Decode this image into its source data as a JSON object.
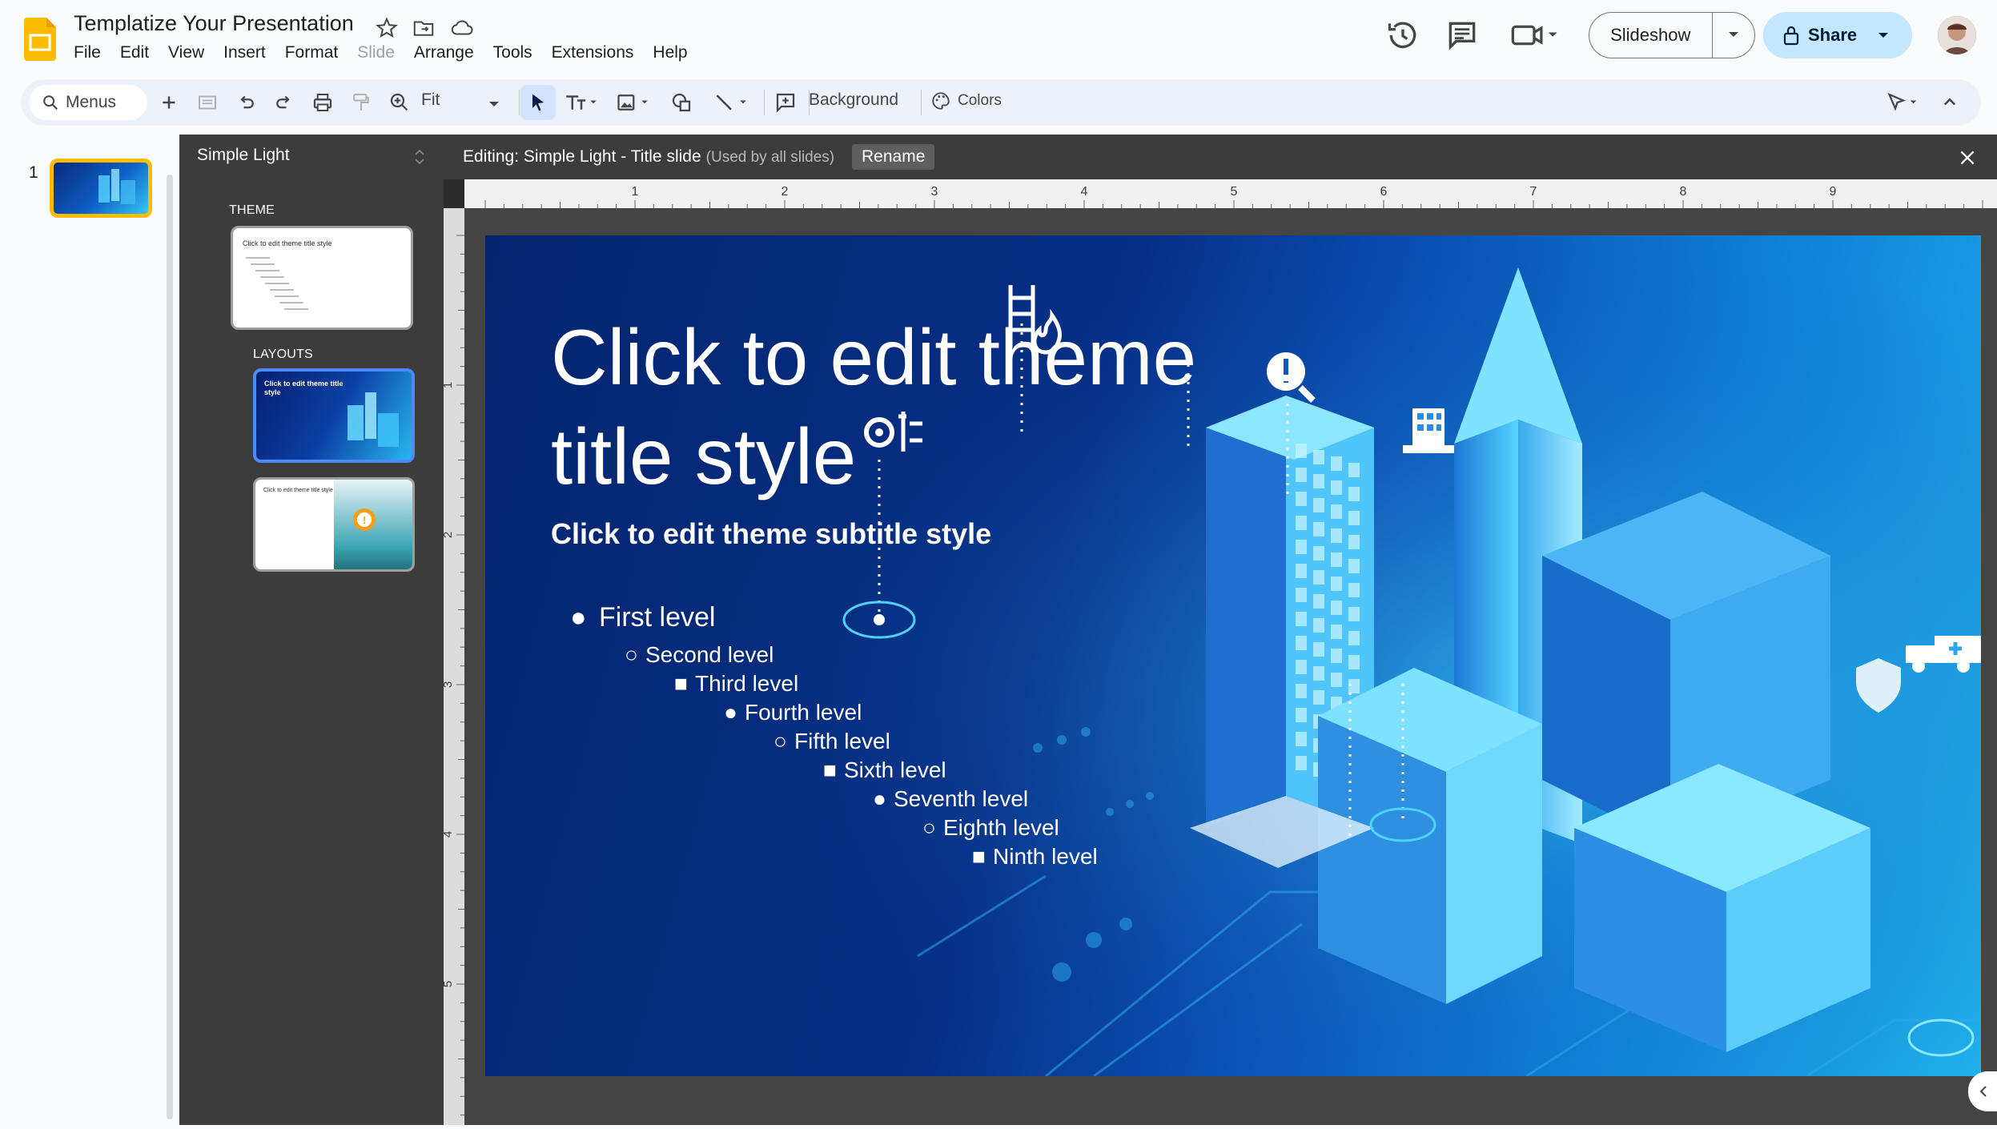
{
  "app": {
    "title": "Templatize Your Presentation",
    "menu": [
      "File",
      "Edit",
      "View",
      "Insert",
      "Format",
      "Slide",
      "Arrange",
      "Tools",
      "Extensions",
      "Help"
    ],
    "disabled_menu": "Slide",
    "slideshow_label": "Slideshow",
    "share_label": "Share"
  },
  "toolbar": {
    "menus_label": "Menus",
    "zoom_label": "Fit",
    "background_label": "Background",
    "colors_label": "Colors"
  },
  "filmstrip": {
    "slide_number": "1"
  },
  "theme_panel": {
    "theme_name": "Simple Light",
    "theme_section": "THEME",
    "layouts_section": "LAYOUTS",
    "theme_thumb_title": "Click to edit theme title style",
    "layout1_title": "Click to edit theme title style",
    "layout2_title": "Click to edit theme title style"
  },
  "editor": {
    "editing_label": "Editing: Simple Light - Title slide",
    "used_label": "(Used by all slides)",
    "rename_label": "Rename",
    "ruler_numbers": [
      "1",
      "2",
      "3",
      "4",
      "5",
      "6",
      "7",
      "8",
      "9"
    ],
    "vruler_numbers": [
      "1",
      "2",
      "3",
      "4",
      "5"
    ]
  },
  "slide": {
    "title": "Click to edit theme title style",
    "subtitle": "Click to edit theme subtitle style",
    "levels": [
      "First level",
      "Second level",
      "Third level",
      "Fourth level",
      "Fifth level",
      "Sixth level",
      "Seventh level",
      "Eighth level",
      "Ninth level"
    ]
  },
  "colors": {
    "accent_blue": "#4c8bf5",
    "selection_yellow": "#fbbc04",
    "share_bg": "#c2e7ff"
  }
}
